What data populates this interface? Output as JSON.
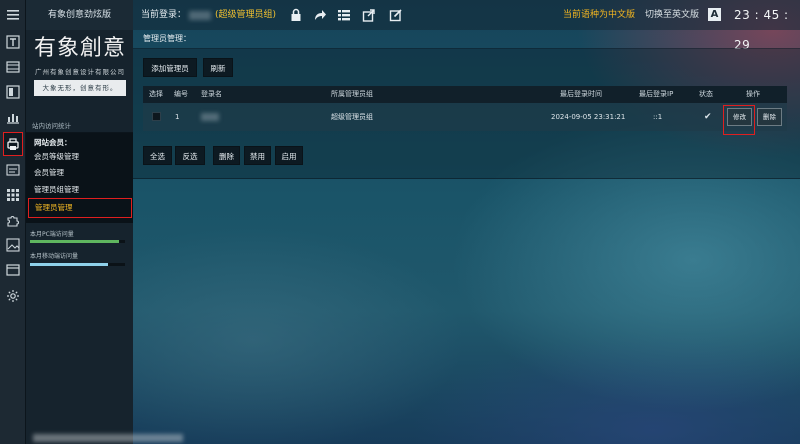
{
  "rail": {
    "items": [
      "menu-icon",
      "text-icon",
      "layout-icon",
      "frame-icon",
      "chart-icon",
      "printer-icon",
      "html-icon",
      "grid-icon",
      "puzzle-icon",
      "image-icon",
      "window-icon",
      "gear-icon"
    ]
  },
  "sidebar": {
    "title": "有象创意劲炫版",
    "logo_main": "有象創意",
    "logo_sub": "广州有象创意设计有限公司",
    "logo_slogan": "大象无形，创意有形。",
    "section": "站内访问统计",
    "group_head": "网站会员：",
    "items": [
      "会员等级管理",
      "会员管理",
      "管理员组管理",
      "管理员管理"
    ],
    "active_item": "管理员管理",
    "stat_pc_label": "本月PC端访问量",
    "stat_mobile_label": "本月移动端访问量",
    "stat_pc_fill": 0.94,
    "stat_mobile_fill": 0.82,
    "stat_pc_color": "#5fb65f",
    "stat_mobile_color": "#8fd1ea"
  },
  "topbar": {
    "login_label": "当前登录：",
    "user_group": "(超级管理员组)",
    "lang_current": "当前语种为中文版",
    "lang_switch": "切换至英文版",
    "lang_icon_letter": "A",
    "clock": "23 : 45 : 29",
    "icons": [
      "lock-icon",
      "share-icon",
      "list-icon",
      "export-icon",
      "edit-window-icon"
    ]
  },
  "content": {
    "title": "管理员管理：",
    "add_button": "添加管理员",
    "refresh_button": "刷新",
    "columns": [
      "选择",
      "编号",
      "登录名",
      "所属管理员组",
      "最后登录时间",
      "最后登录IP",
      "状态",
      "操作"
    ],
    "rows": [
      {
        "id": "1",
        "login_name": "",
        "group": "超级管理员组",
        "last_login_time": "2024-09-05 23:31:21",
        "last_login_ip": "::1",
        "status": "✔",
        "edit_label": "修改",
        "delete_label": "删除"
      }
    ],
    "bulk_buttons": [
      "全选",
      "反选",
      "删除",
      "禁用",
      "启用"
    ]
  }
}
